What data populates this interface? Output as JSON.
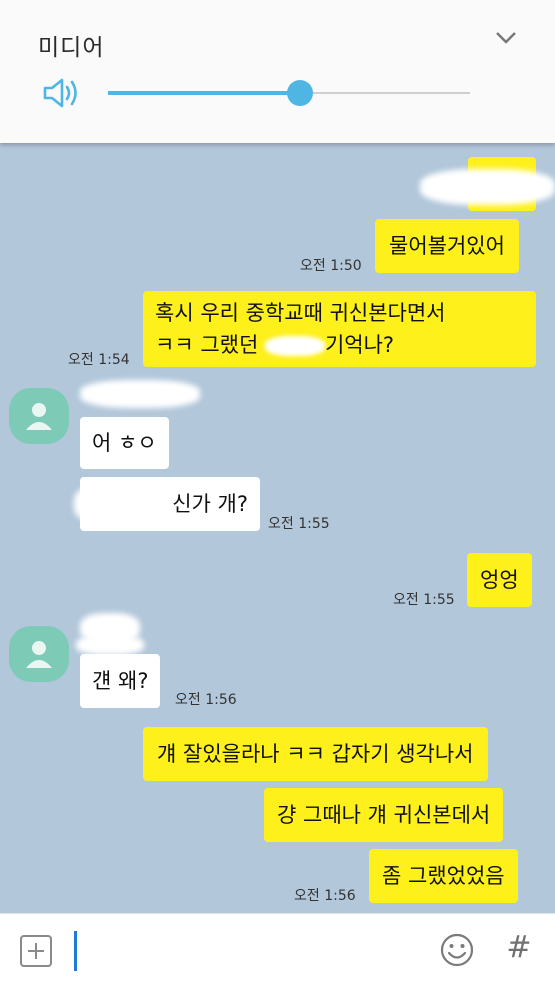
{
  "media_panel": {
    "title": "미디어",
    "volume_level": 0.53,
    "accent_color": "#4fb6e4",
    "icons": {
      "speaker": "speaker-icon",
      "collapse": "chevron-down-icon"
    }
  },
  "messages": [
    {
      "sender": "me",
      "text": "",
      "redacted": true
    },
    {
      "sender": "me",
      "text": "물어볼거있어",
      "time": "오전 1:50"
    },
    {
      "sender": "me",
      "line1": "혹시 우리 중학교때 귀신본다면서",
      "line2a": "ㅋㅋ 그랬던 ",
      "line2b": "기억나?",
      "time": "오전 1:54"
    },
    {
      "sender": "other",
      "text": "어 ㅎㅇ"
    },
    {
      "sender": "other",
      "text": "신가 개?",
      "time": "오전 1:55"
    },
    {
      "sender": "me",
      "text": "엉엉",
      "time": "오전 1:55"
    },
    {
      "sender": "other",
      "text": "걘 왜?",
      "time": "오전 1:56"
    },
    {
      "sender": "me",
      "text": "걔 잘있을라나 ㅋㅋ 갑자기 생각나서"
    },
    {
      "sender": "me",
      "text": "걍 그때나 걔 귀신본데서"
    },
    {
      "sender": "me",
      "text": "좀 그랬었었음",
      "time": "오전 1:56"
    }
  ],
  "colors": {
    "chat_background": "#b2c7da",
    "my_bubble": "#fef01b",
    "their_bubble": "#ffffff",
    "avatar": "#7dcab6"
  },
  "input_bar": {
    "placeholder": "",
    "hash_label": "#",
    "icons": {
      "attach": "plus-icon",
      "emoji": "emoji-icon",
      "hash": "hashtag-icon"
    }
  }
}
